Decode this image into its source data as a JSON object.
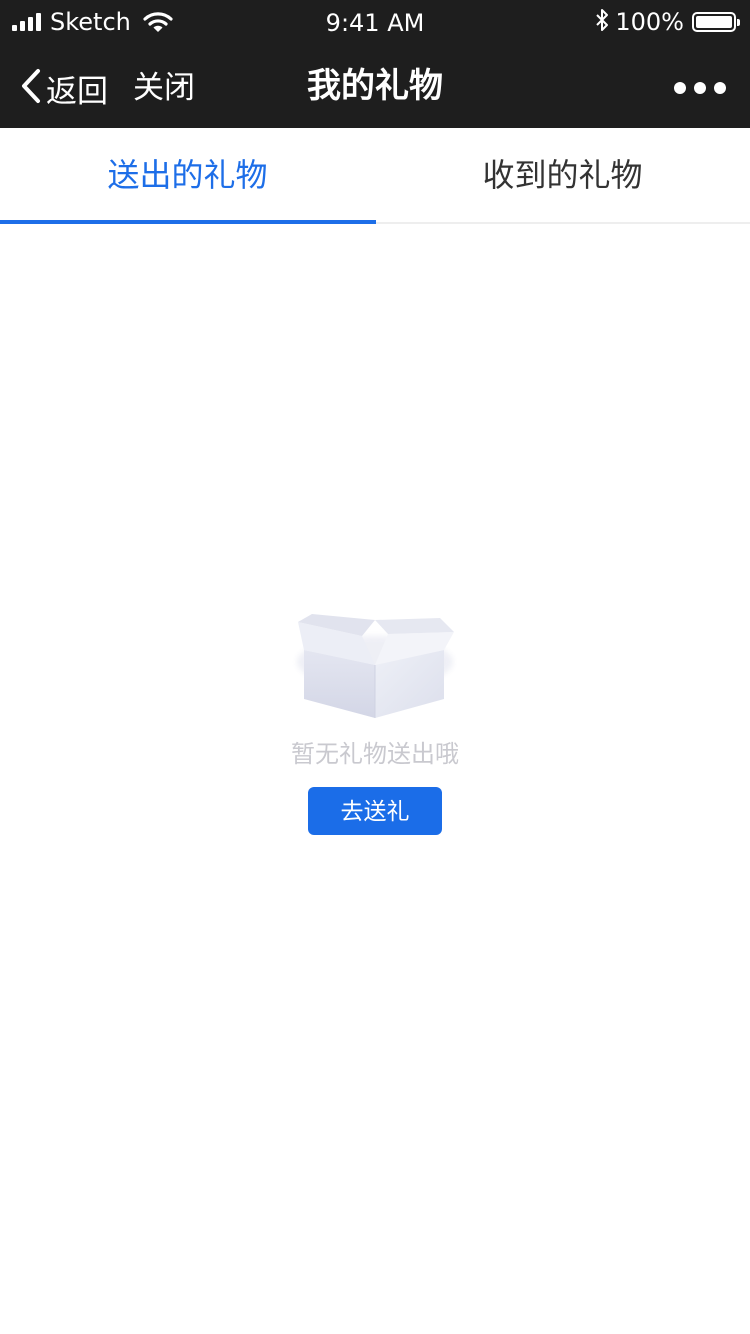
{
  "status_bar": {
    "carrier": "Sketch",
    "time": "9:41 AM",
    "battery": "100%",
    "battery_level": 1.0,
    "icons": [
      "signal-bars-icon",
      "wifi-icon",
      "bluetooth-icon",
      "battery-icon"
    ]
  },
  "nav": {
    "back_label": "返回",
    "close_label": "关闭",
    "title": "我的礼物",
    "more_icon": "ellipsis-icon"
  },
  "tabs": [
    {
      "label": "送出的礼物",
      "active": true
    },
    {
      "label": "收到的礼物",
      "active": false
    }
  ],
  "empty_state": {
    "icon": "empty-box-icon",
    "message": "暂无礼物送出哦",
    "button_label": "去送礼"
  },
  "colors": {
    "accent": "#1d6ee8",
    "nav_background": "#1e1e1e",
    "muted_text": "#c9c9cf"
  }
}
